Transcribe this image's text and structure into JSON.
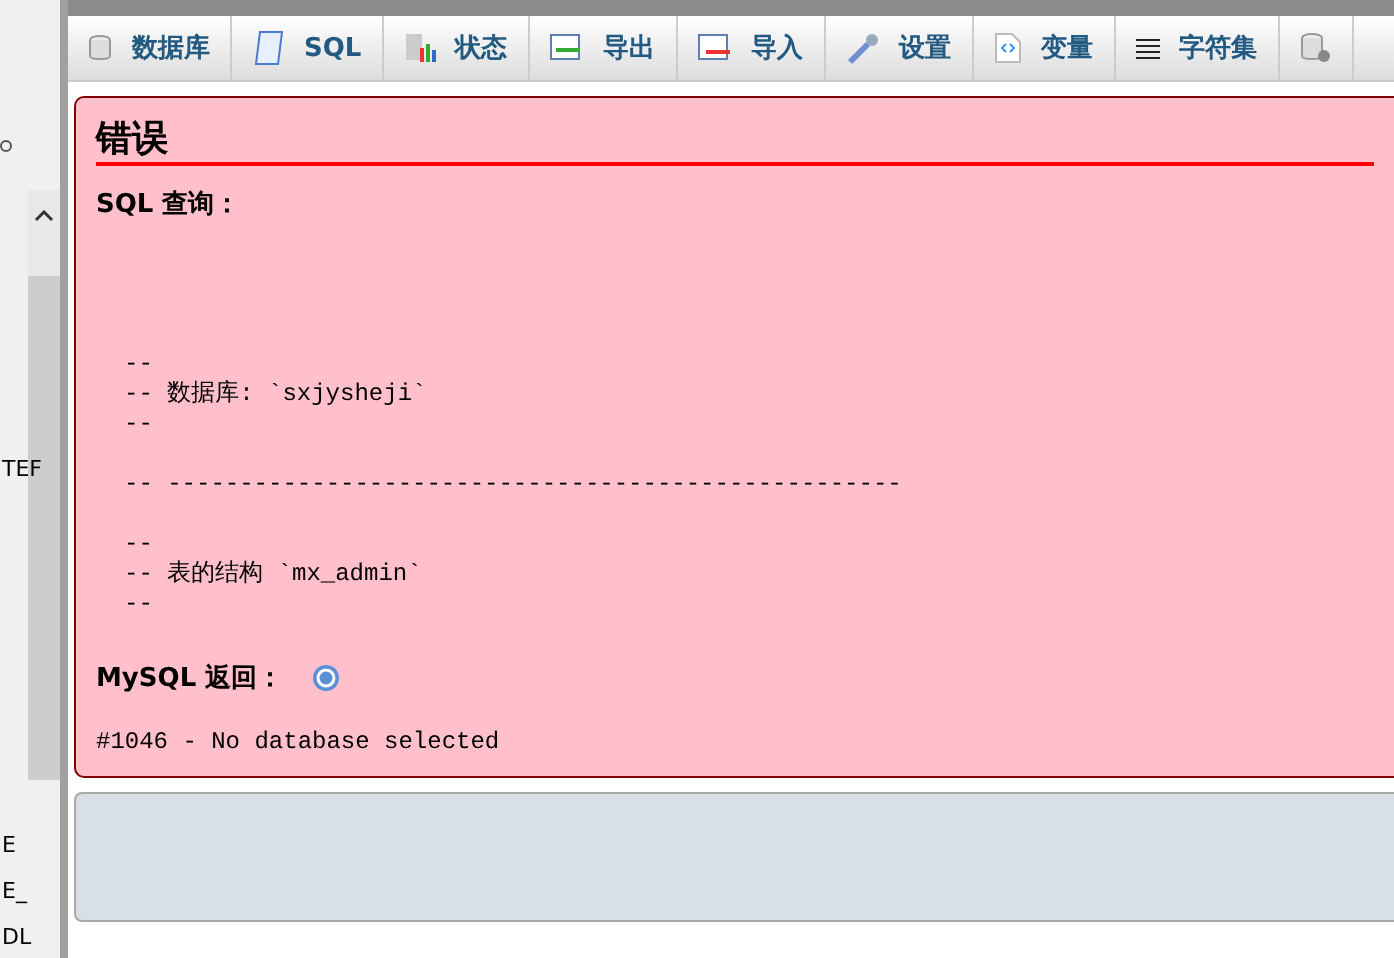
{
  "sidebar": {
    "fragments": [
      {
        "text": "TEF"
      },
      {
        "text": "E"
      },
      {
        "text": "E_"
      },
      {
        "text": "DL"
      }
    ]
  },
  "tabs": [
    {
      "label": "数据库",
      "kind": "database"
    },
    {
      "label": "SQL",
      "kind": "scroll"
    },
    {
      "label": "状态",
      "kind": "chart"
    },
    {
      "label": "导出",
      "kind": "export"
    },
    {
      "label": "导入",
      "kind": "import"
    },
    {
      "label": "设置",
      "kind": "wrench"
    },
    {
      "label": "变量",
      "kind": "code"
    },
    {
      "label": "字符集",
      "kind": "lines"
    },
    {
      "kind": "dbgear"
    }
  ],
  "error": {
    "title": "错误",
    "query_label": "SQL 查询：",
    "query": "--\n-- 数据库: `sxjysheji`\n--\n\n-- ---------------------------------------------------\n\n--\n-- 表的结构 `mx_admin`\n--",
    "return_label": "MySQL 返回：",
    "message": "#1046 - No database selected"
  }
}
